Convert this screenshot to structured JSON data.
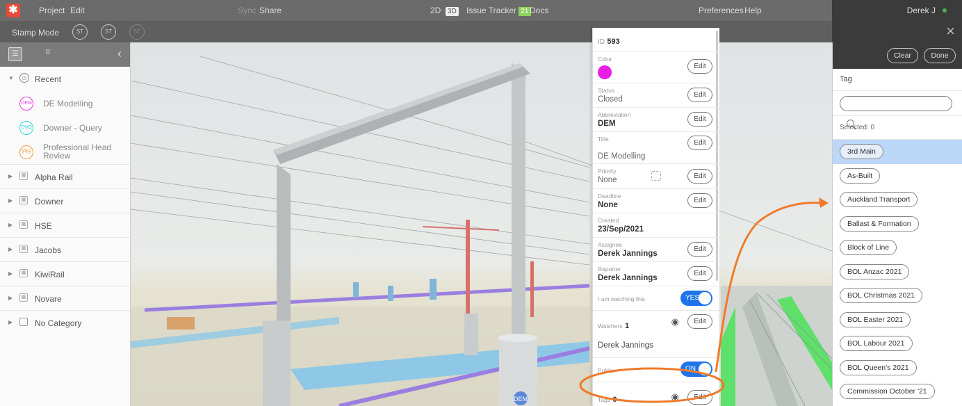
{
  "topbar": {
    "logo": "✱",
    "project": "Project",
    "edit": "Edit",
    "sync": "Sync",
    "share": "Share",
    "view_2d": "2D",
    "view_3d": "3D",
    "issue_tracker": "Issue Tracker",
    "issue_count": "21",
    "docs": "Docs",
    "preferences": "Preferences",
    "help": "Help",
    "user": "Derek J",
    "status_color": "#4caf50"
  },
  "stampbar": {
    "label": "Stamp Mode",
    "stamp1": "ST",
    "stamp2": "ST",
    "stamp3": "ST",
    "close": "×"
  },
  "sidebar": {
    "collapse": "‹",
    "recent": {
      "label": "Recent",
      "items": [
        {
          "abbr": "DEM",
          "label": "DE Modelling",
          "color": "#e03ee0"
        },
        {
          "abbr": "DNQ",
          "label": "Downer - Query",
          "color": "#35d0dc"
        },
        {
          "abbr": "PH",
          "label_line1": "Professional Head",
          "label_line2": "Review",
          "color": "#f0983c"
        }
      ]
    },
    "categories": [
      "Alpha Rail",
      "Downer",
      "HSE",
      "Jacobs",
      "KiwiRail",
      "Novare",
      "No Category"
    ]
  },
  "scene": {
    "marker": "DEM"
  },
  "issue": {
    "id_label": "ID",
    "id": "593",
    "edit": "Edit",
    "color": {
      "label": "Color",
      "value": "#e61ee6"
    },
    "status": {
      "label": "Status",
      "value": "Closed"
    },
    "abbreviation": {
      "label": "Abbreviation",
      "value": "DEM"
    },
    "title": {
      "label": "Title",
      "value": "DE Modelling"
    },
    "priority": {
      "label": "Priority",
      "value": "None"
    },
    "deadline": {
      "label": "Deadline",
      "value": "None"
    },
    "created": {
      "label": "Created",
      "value": "23/Sep/2021"
    },
    "assignee": {
      "label": "Assignee",
      "value": "Derek Jannings"
    },
    "reporter": {
      "label": "Reporter",
      "value": "Derek Jannings"
    },
    "watching": {
      "label": "I am watching this",
      "value": "YES"
    },
    "watchers": {
      "label": "Watchers",
      "count": "1",
      "name": "Derek Jannings"
    },
    "public": {
      "label": "Public",
      "value": "ON"
    },
    "tags": {
      "label": "Tags",
      "count": "0"
    }
  },
  "tags": {
    "clear": "Clear",
    "done": "Done",
    "title": "Tag",
    "search_placeholder": "",
    "selected_label": "Selected:",
    "selected_count": "0",
    "items": [
      "3rd Main",
      "As-Built",
      "Auckland Transport",
      "Ballast & Formation",
      "Block of Line",
      "BOL Anzac 2021",
      "BOL Christmas 2021",
      "BOL Easter 2021",
      "BOL Labour 2021",
      "BOL Queen's 2021",
      "Commission October '21"
    ]
  },
  "annotation_color": "#f07a2a"
}
